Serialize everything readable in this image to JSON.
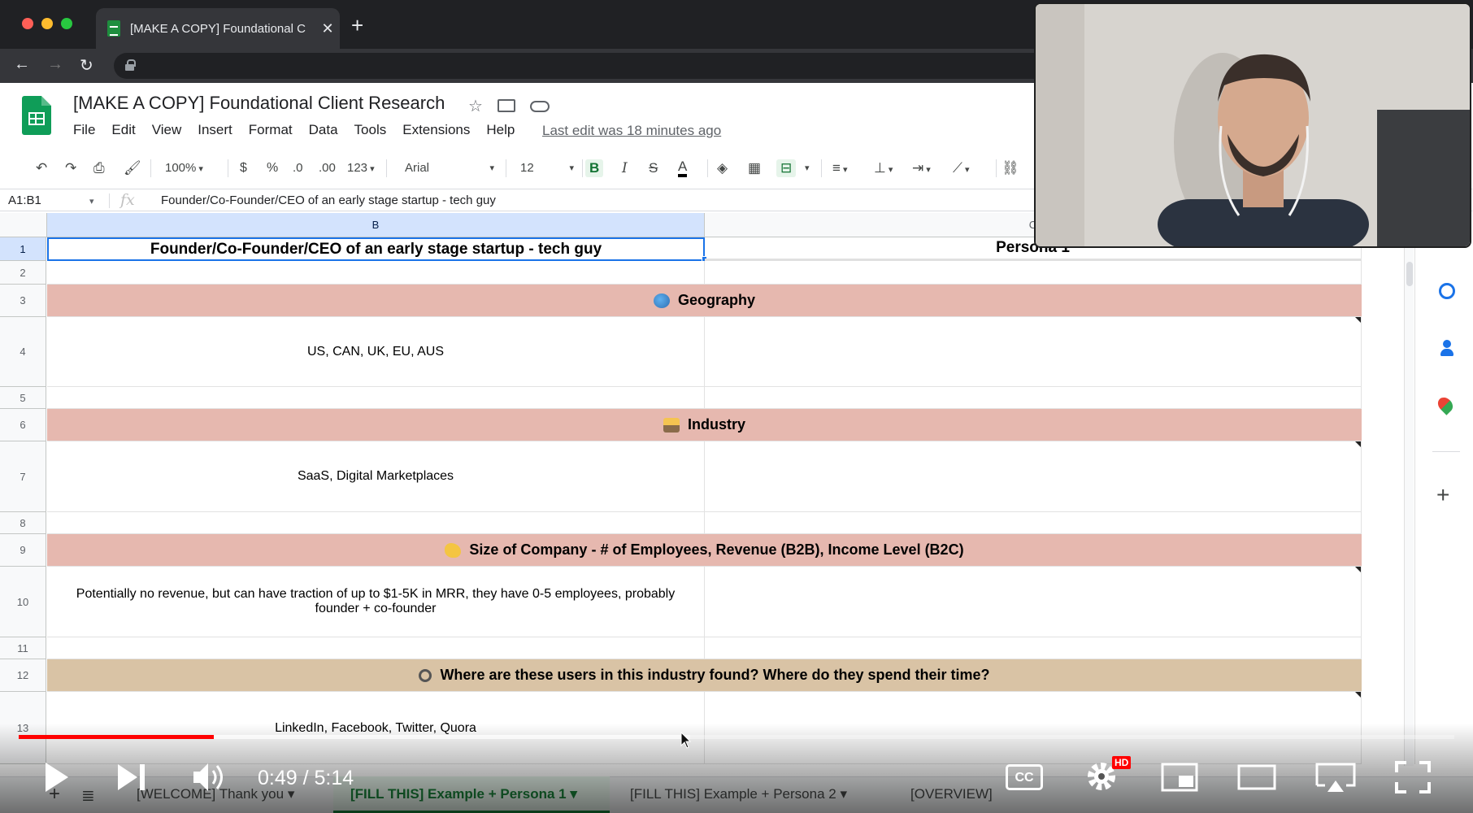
{
  "browser": {
    "tab_title": "[MAKE A COPY] Foundational C",
    "tab_close": "✕",
    "new_tab": "+",
    "back_icon": "←",
    "forward_icon": "→",
    "reload_icon": "↻"
  },
  "sheets": {
    "doc_title": "[MAKE A COPY] Foundational Client Research",
    "menu": [
      "File",
      "Edit",
      "View",
      "Insert",
      "Format",
      "Data",
      "Tools",
      "Extensions",
      "Help"
    ],
    "last_edit": "Last edit was 18 minutes ago",
    "toolbar": {
      "zoom": "100%",
      "currency": "$",
      "percent": "%",
      "dec_decrease": ".0",
      "dec_increase": ".00",
      "more_formats": "123",
      "font": "Arial",
      "font_size": "12",
      "bold": "B",
      "italic": "I",
      "strike": "S",
      "text_color": "A"
    },
    "name_box": "A1:B1",
    "fx": "fx",
    "formula": "Founder/Co-Founder/CEO of an early stage startup - tech guy"
  },
  "grid": {
    "columns": [
      "B",
      "C"
    ],
    "rows": [
      "1",
      "2",
      "3",
      "4",
      "5",
      "6",
      "7",
      "8",
      "9",
      "10",
      "11",
      "12",
      "13"
    ],
    "header_cell": "Founder/Co-Founder/CEO of an early stage startup - tech guy",
    "persona_cell": "Persona 1",
    "sections": [
      {
        "label": "Geography",
        "answer": "US, CAN, UK, EU, AUS"
      },
      {
        "label": "Industry",
        "answer": "SaaS, Digital Marketplaces"
      },
      {
        "label": "Size of Company - # of Employees, Revenue (B2B), Income Level (B2C)",
        "answer": "Potentially no revenue, but can have traction of up to $1-5K in MRR, they have 0-5 employees, probably founder + co-founder"
      },
      {
        "label": "Where are these users in this industry found? Where do they spend their time?",
        "answer": "LinkedIn, Facebook, Twitter, Quora"
      }
    ],
    "colors": {
      "section_pink": "#e6b8af",
      "section_tan": "#d9c3a5",
      "selection": "#1a73e8"
    }
  },
  "sheet_tabs": [
    "[WELCOME] Thank you",
    "[FILL THIS] Example + Persona 1",
    "[FILL THIS] Example + Persona 2",
    "[OVERVIEW]"
  ],
  "video": {
    "time": "0:49 / 5:14",
    "progress": 0.136,
    "buffered": 0.468,
    "cc": "CC",
    "hd": "HD"
  }
}
